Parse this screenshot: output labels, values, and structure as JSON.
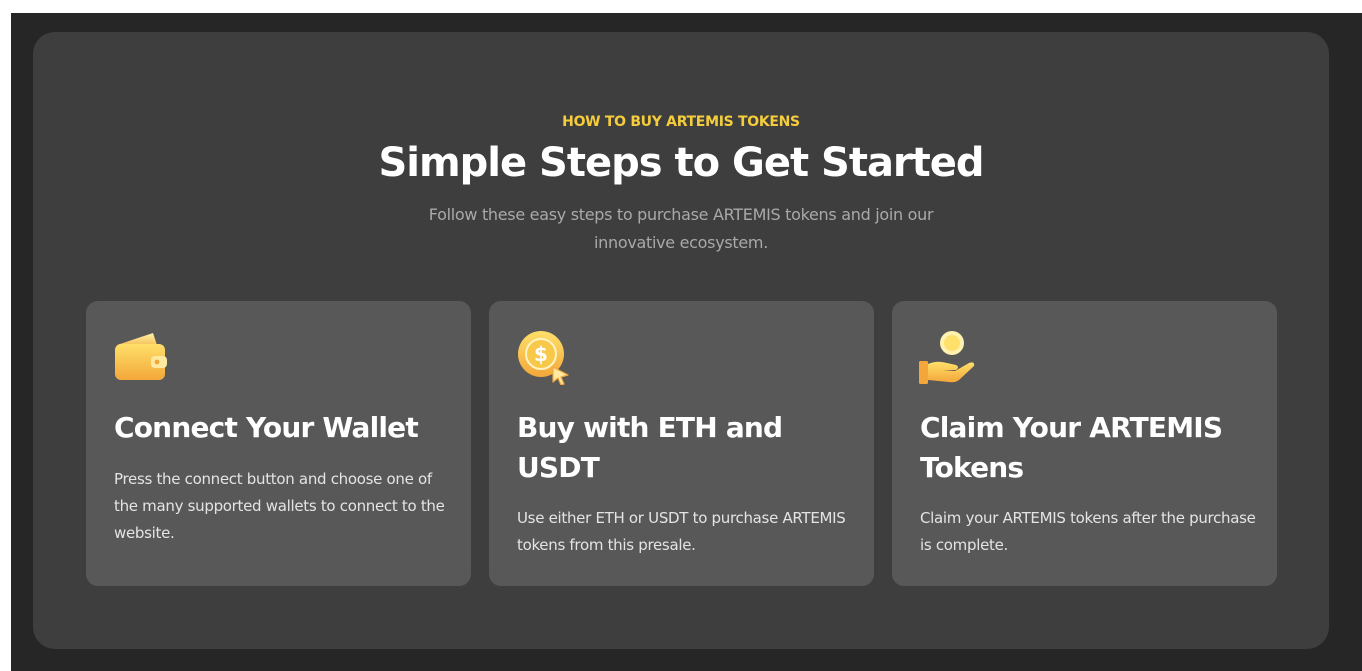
{
  "section": {
    "eyebrow": "HOW TO BUY ARTEMIS TOKENS",
    "title": "Simple Steps to Get Started",
    "subtitle": "Follow these easy steps to purchase ARTEMIS tokens and join our innovative ecosystem."
  },
  "steps": [
    {
      "icon": "wallet-icon",
      "title": "Connect Your Wallet",
      "description": "Press the connect button and choose one of the many supported wallets to connect to the website."
    },
    {
      "icon": "dollar-coin-cursor-icon",
      "title": "Buy with ETH and USDT",
      "description": "Use either ETH or USDT to purchase ARTEMIS tokens from this presale."
    },
    {
      "icon": "hand-coin-icon",
      "title": "Claim Your ARTEMIS Tokens",
      "description": "Claim your ARTEMIS tokens after the purchase is complete."
    }
  ],
  "colors": {
    "accent": "#f5cd3c",
    "background": "#262626",
    "panel": "#3e3e3e",
    "card": "#585858"
  }
}
